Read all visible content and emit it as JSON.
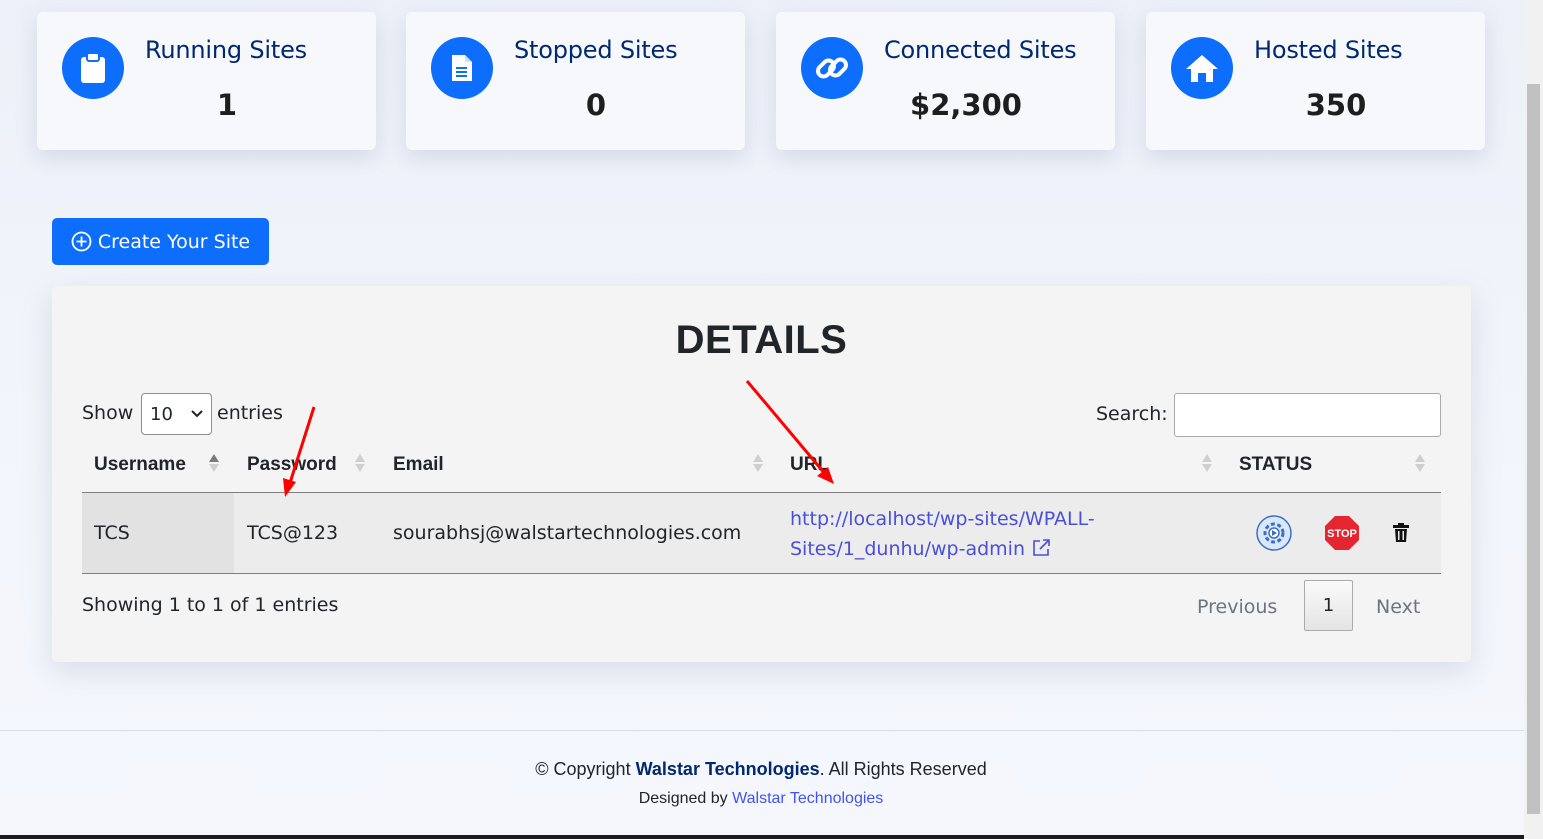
{
  "stats": [
    {
      "title": "Running Sites",
      "value": "1",
      "icon": "clipboard-icon"
    },
    {
      "title": "Stopped Sites",
      "value": "0",
      "icon": "document-icon"
    },
    {
      "title": "Connected Sites",
      "value": "$2,300",
      "icon": "link-icon"
    },
    {
      "title": "Hosted Sites",
      "value": "350",
      "icon": "home-icon"
    }
  ],
  "create_button": "Create Your Site",
  "details": {
    "title": "DETAILS",
    "show_label": "Show",
    "entries_label": "entries",
    "page_length": "10",
    "search_label": "Search:",
    "search_value": "",
    "columns": [
      "Username",
      "Password",
      "Email",
      "URL",
      "STATUS"
    ],
    "rows": [
      {
        "username": "TCS",
        "password": "TCS@123",
        "email": "sourabhsj@walstartechnologies.com",
        "url": "http://localhost/wp-sites/WPALL-Sites/1_dunhu/wp-admin",
        "url_line1": "http://localhost/wp-sites/WPALL-",
        "url_line2": "Sites/1_dunhu/wp-admin"
      }
    ],
    "info": "Showing 1 to 1 of 1 entries",
    "pager": {
      "previous": "Previous",
      "current": "1",
      "next": "Next"
    }
  },
  "footer": {
    "copyright_prefix": "© Copyright",
    "company": "Walstar Technologies",
    "rights": ". All Rights Reserved",
    "designed_by": "Designed by",
    "designer": "Walstar Technologies"
  },
  "colors": {
    "accent": "#0d6efd",
    "title": "#012970",
    "link": "#4a4fd8",
    "annotation": "#ff0000"
  }
}
